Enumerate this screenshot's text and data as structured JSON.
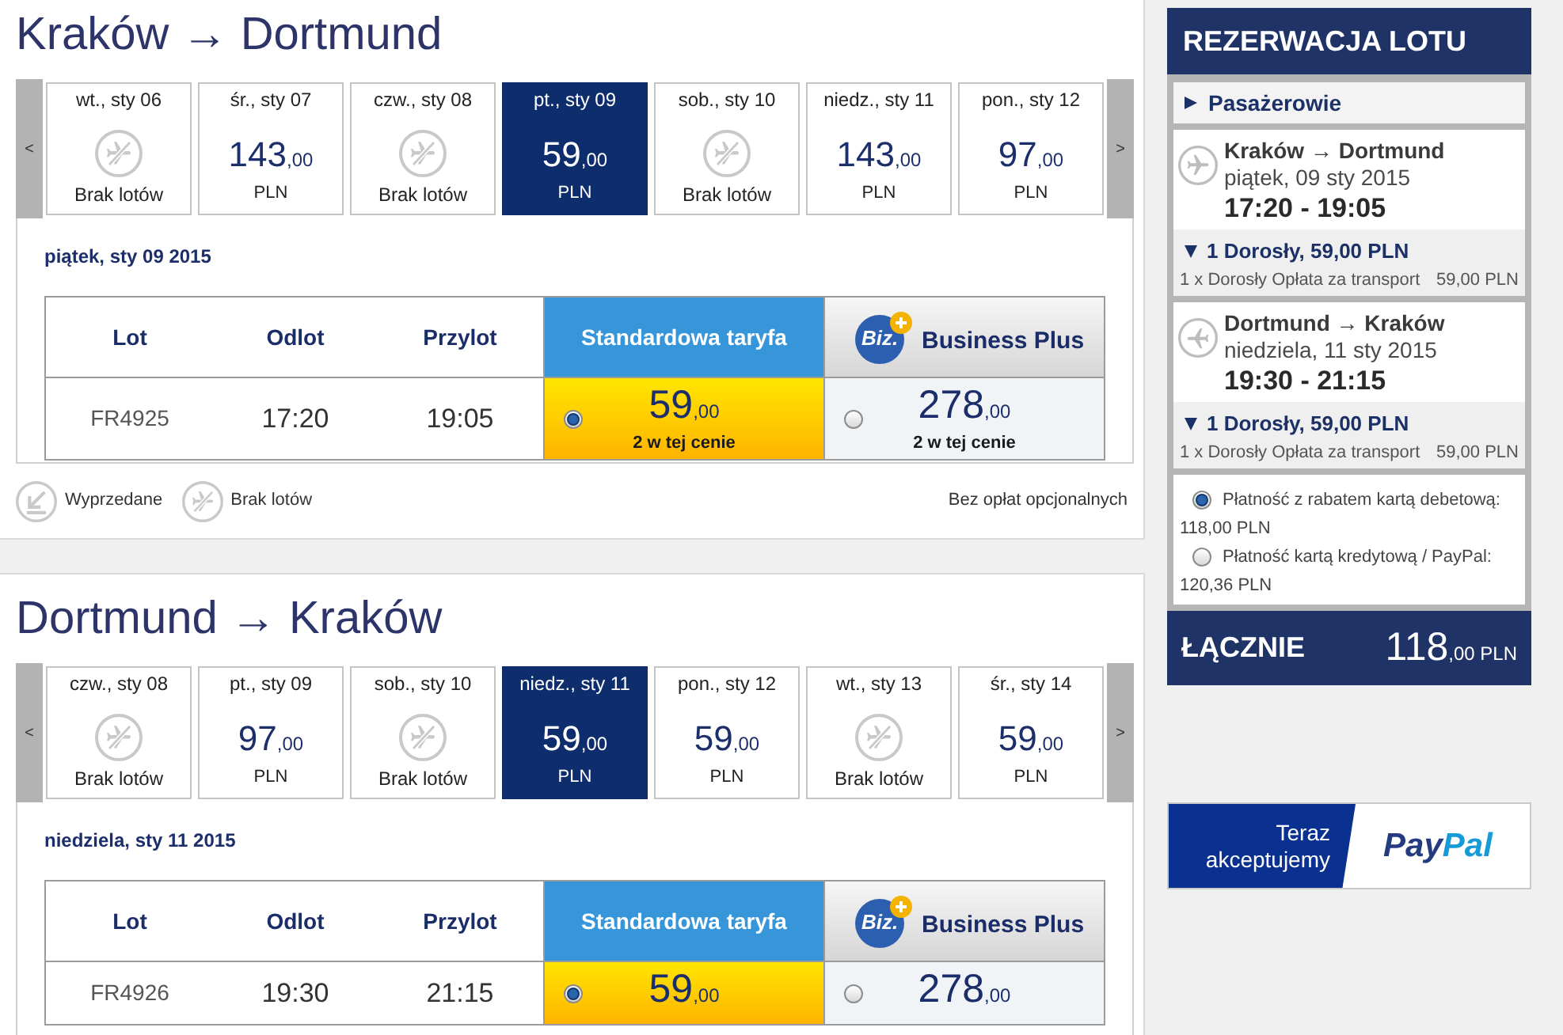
{
  "journeys": [
    {
      "title": "Kraków → Dortmund",
      "date_strip": {
        "prev": "<",
        "next": ">",
        "days": [
          {
            "date": "wt., sty 06",
            "kind": "none",
            "note": "Brak lotów",
            "selected": false
          },
          {
            "date": "śr., sty 07",
            "kind": "price",
            "amount": "143",
            "decimals": ",00",
            "currency": "PLN",
            "selected": false
          },
          {
            "date": "czw., sty 08",
            "kind": "none",
            "note": "Brak lotów",
            "selected": false
          },
          {
            "date": "pt., sty 09",
            "kind": "price",
            "amount": "59",
            "decimals": ",00",
            "currency": "PLN",
            "selected": true
          },
          {
            "date": "sob., sty 10",
            "kind": "none",
            "note": "Brak lotów",
            "selected": false
          },
          {
            "date": "niedz., sty 11",
            "kind": "price",
            "amount": "143",
            "decimals": ",00",
            "currency": "PLN",
            "selected": false
          },
          {
            "date": "pon., sty 12",
            "kind": "price",
            "amount": "97",
            "decimals": ",00",
            "currency": "PLN",
            "selected": false
          }
        ]
      },
      "date_heading": "piątek, sty 09 2015",
      "fare_table": {
        "columns": [
          "Lot",
          "Odlot",
          "Przylot"
        ],
        "fare_headers": [
          {
            "kind": "standard",
            "label": "Standardowa taryfa"
          },
          {
            "kind": "business",
            "logo": "Biz.",
            "label": "Business Plus"
          }
        ],
        "rows": [
          {
            "flight": "FR4925",
            "departure": "17:20",
            "arrival": "19:05",
            "fares": [
              {
                "kind": "standard",
                "amount": "59",
                "decimals": ",00",
                "note": "2 w tej cenie",
                "selected": true
              },
              {
                "kind": "business",
                "amount": "278",
                "decimals": ",00",
                "note": "2 w tej cenie",
                "selected": false
              }
            ]
          }
        ]
      },
      "legend": [
        {
          "kind": "sold_out",
          "label": "Wyprzedane"
        },
        {
          "kind": "no_flights",
          "label": "Brak lotów"
        }
      ],
      "legend_note": "Bez opłat opcjonalnych"
    },
    {
      "title": "Dortmund → Kraków",
      "date_strip": {
        "prev": "<",
        "next": ">",
        "days": [
          {
            "date": "czw., sty 08",
            "kind": "none",
            "note": "Brak lotów",
            "selected": false
          },
          {
            "date": "pt., sty 09",
            "kind": "price",
            "amount": "97",
            "decimals": ",00",
            "currency": "PLN",
            "selected": false
          },
          {
            "date": "sob., sty 10",
            "kind": "none",
            "note": "Brak lotów",
            "selected": false
          },
          {
            "date": "niedz., sty 11",
            "kind": "price",
            "amount": "59",
            "decimals": ",00",
            "currency": "PLN",
            "selected": true
          },
          {
            "date": "pon., sty 12",
            "kind": "price",
            "amount": "59",
            "decimals": ",00",
            "currency": "PLN",
            "selected": false
          },
          {
            "date": "wt., sty 13",
            "kind": "none",
            "note": "Brak lotów",
            "selected": false
          },
          {
            "date": "śr., sty 14",
            "kind": "price",
            "amount": "59",
            "decimals": ",00",
            "currency": "PLN",
            "selected": false
          }
        ]
      },
      "date_heading": "niedziela, sty 11 2015",
      "fare_table": {
        "columns": [
          "Lot",
          "Odlot",
          "Przylot"
        ],
        "fare_headers": [
          {
            "kind": "standard",
            "label": "Standardowa taryfa"
          },
          {
            "kind": "business",
            "logo": "Biz.",
            "label": "Business Plus"
          }
        ],
        "rows": [
          {
            "flight": "FR4926",
            "departure": "19:30",
            "arrival": "21:15",
            "fares": [
              {
                "kind": "standard",
                "amount": "59",
                "decimals": ",00",
                "selected": true
              },
              {
                "kind": "business",
                "amount": "278",
                "decimals": ",00",
                "selected": false
              }
            ]
          }
        ]
      }
    }
  ],
  "booking": {
    "title": "REZERWACJA LOTU",
    "passengers": {
      "label": "Pasażerowie",
      "expanded": false
    },
    "flights": [
      {
        "kind": "outbound",
        "route": "Kraków → Dortmund",
        "date": "piątek, 09 sty 2015",
        "time": "17:20 - 19:05",
        "fare": {
          "label": "1 Dorosły, 59,00 PLN",
          "expanded": true,
          "items": [
            {
              "label": "1 x Dorosły Opłata za transport",
              "amount": "59,00 PLN"
            }
          ]
        }
      },
      {
        "kind": "return",
        "route": "Dortmund → Kraków",
        "date": "niedziela, 11 sty 2015",
        "time": "19:30 - 21:15",
        "fare": {
          "label": "1 Dorosły, 59,00 PLN",
          "expanded": true,
          "items": [
            {
              "label": "1 x Dorosły Opłata za transport",
              "amount": "59,00 PLN"
            }
          ]
        }
      }
    ],
    "payment_options": [
      {
        "label": "Płatność z rabatem kartą debetową:",
        "amount": "118,00 PLN",
        "selected": true
      },
      {
        "label": "Płatność kartą kredytową / PayPal:",
        "amount": "120,36 PLN",
        "selected": false
      }
    ],
    "total": {
      "label": "ŁĄCZNIE",
      "amount": "118",
      "decimals": ",00",
      "currency": "PLN"
    }
  },
  "paypal_banner": {
    "text": "Teraz akceptujemy",
    "logo_parts": [
      "Pay",
      "Pal"
    ]
  }
}
